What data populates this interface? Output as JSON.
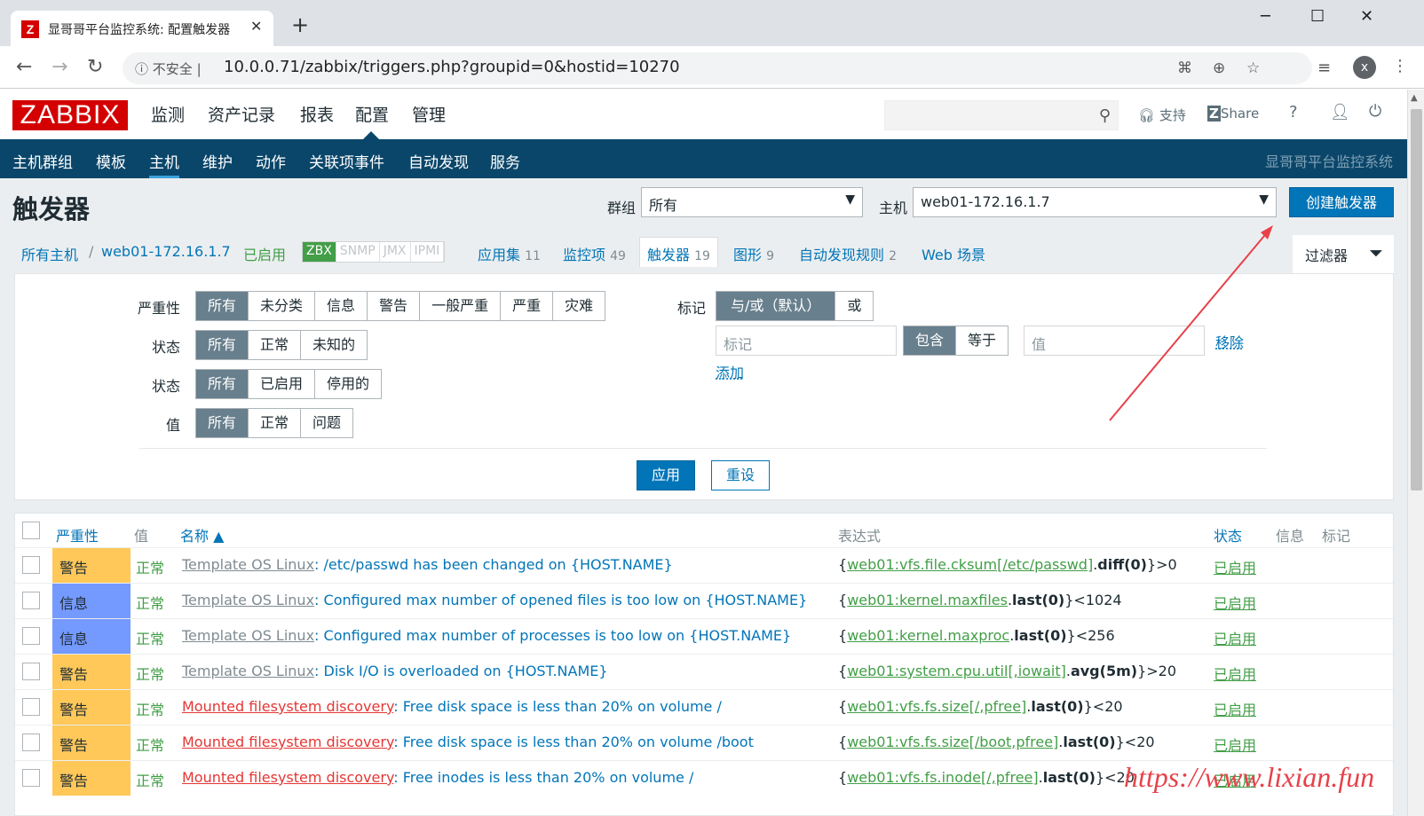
{
  "browser": {
    "tab_title": "显哥哥平台监控系统: 配置触发器",
    "tab_favicon": "Z",
    "tab_close": "✕",
    "new_tab": "+",
    "insecure_label": "不安全",
    "url": "10.0.0.71/zabbix/triggers.php?groupid=0&hostid=10270",
    "avatar": "x"
  },
  "header": {
    "logo": "ZABBIX",
    "menu": [
      "监测",
      "资产记录",
      "报表",
      "配置",
      "管理"
    ],
    "support": "支持",
    "share": "Share",
    "help": "?"
  },
  "subnav": {
    "items": [
      "主机群组",
      "模板",
      "主机",
      "维护",
      "动作",
      "关联项事件",
      "自动发现",
      "服务"
    ],
    "active": "主机",
    "system_name": "显哥哥平台监控系统"
  },
  "page": {
    "title": "触发器",
    "group_label": "群组",
    "group_value": "所有",
    "host_label": "主机",
    "host_value": "web01-172.16.1.7",
    "create_button": "创建触发器"
  },
  "breadcrumb": {
    "all_hosts": "所有主机",
    "sep": "/",
    "host": "web01-172.16.1.7",
    "enabled": "已启用",
    "availability": [
      "ZBX",
      "SNMP",
      "JMX",
      "IPMI"
    ],
    "tabs": [
      {
        "label": "应用集",
        "count": "11"
      },
      {
        "label": "监控项",
        "count": "49"
      },
      {
        "label": "触发器",
        "count": "19"
      },
      {
        "label": "图形",
        "count": "9"
      },
      {
        "label": "自动发现规则",
        "count": "2"
      },
      {
        "label": "Web 场景",
        "count": ""
      }
    ],
    "filter_tab": "过滤器"
  },
  "filter": {
    "severity_label": "严重性",
    "severity_options": [
      "所有",
      "未分类",
      "信息",
      "警告",
      "一般严重",
      "严重",
      "灾难"
    ],
    "state_label": "状态",
    "state_options": [
      "所有",
      "正常",
      "未知的"
    ],
    "status_label": "状态",
    "status_options": [
      "所有",
      "已启用",
      "停用的"
    ],
    "value_label": "值",
    "value_options": [
      "所有",
      "正常",
      "问题"
    ],
    "tags_label": "标记",
    "tag_eval_options": [
      "与/或（默认）",
      "或"
    ],
    "tag_placeholder": "标记",
    "tag_op_options": [
      "包含",
      "等于"
    ],
    "value_placeholder": "值",
    "remove": "移除",
    "add": "添加",
    "apply": "应用",
    "reset": "重设"
  },
  "table": {
    "headers": {
      "severity": "严重性",
      "value": "值",
      "name": "名称 ▲",
      "expression": "表达式",
      "status": "状态",
      "info": "信息",
      "tags": "标记"
    },
    "rows": [
      {
        "severity": "警告",
        "value": "正常",
        "prefix": "Template OS Linux",
        "prefix_kind": "template",
        "name": "/etc/passwd has been changed on {HOST.NAME}",
        "e1": "{",
        "ekey": "web01:vfs.file.cksum[/etc/passwd]",
        "efunc": "diff(0)",
        "etail": "}>0",
        "status": "已启用"
      },
      {
        "severity": "信息",
        "value": "正常",
        "prefix": "Template OS Linux",
        "prefix_kind": "template",
        "name": "Configured max number of opened files is too low on {HOST.NAME}",
        "e1": "{",
        "ekey": "web01:kernel.maxfiles",
        "efunc": "last(0)",
        "etail": "}<1024",
        "status": "已启用"
      },
      {
        "severity": "信息",
        "value": "正常",
        "prefix": "Template OS Linux",
        "prefix_kind": "template",
        "name": "Configured max number of processes is too low on {HOST.NAME}",
        "e1": "{",
        "ekey": "web01:kernel.maxproc",
        "efunc": "last(0)",
        "etail": "}<256",
        "status": "已启用"
      },
      {
        "severity": "警告",
        "value": "正常",
        "prefix": "Template OS Linux",
        "prefix_kind": "template",
        "name": "Disk I/O is overloaded on {HOST.NAME}",
        "e1": "{",
        "ekey": "web01:system.cpu.util[,iowait]",
        "efunc": "avg(5m)",
        "etail": "}>20",
        "status": "已启用"
      },
      {
        "severity": "警告",
        "value": "正常",
        "prefix": "Mounted filesystem discovery",
        "prefix_kind": "discovery",
        "name": "Free disk space is less than 20% on volume /",
        "e1": "{",
        "ekey": "web01:vfs.fs.size[/,pfree]",
        "efunc": "last(0)",
        "etail": "}<20",
        "status": "已启用"
      },
      {
        "severity": "警告",
        "value": "正常",
        "prefix": "Mounted filesystem discovery",
        "prefix_kind": "discovery",
        "name": "Free disk space is less than 20% on volume /boot",
        "e1": "{",
        "ekey": "web01:vfs.fs.size[/boot,pfree]",
        "efunc": "last(0)",
        "etail": "}<20",
        "status": "已启用"
      },
      {
        "severity": "警告",
        "value": "正常",
        "prefix": "Mounted filesystem discovery",
        "prefix_kind": "discovery",
        "name": "Free inodes is less than 20% on volume /",
        "e1": "{",
        "ekey": "web01:vfs.fs.inode[/,pfree]",
        "efunc": "last(0)",
        "etail": "}<20",
        "status": "已启用"
      }
    ]
  },
  "colors": {
    "warning": "#ffc859",
    "information": "#7499ff",
    "nav_bg": "#0a466a",
    "accent": "#0275b8",
    "ok_green": "#429e47",
    "logo_red": "#d40000",
    "arrow_red": "#e8414a"
  },
  "watermark": "https://www.lixian.fun"
}
